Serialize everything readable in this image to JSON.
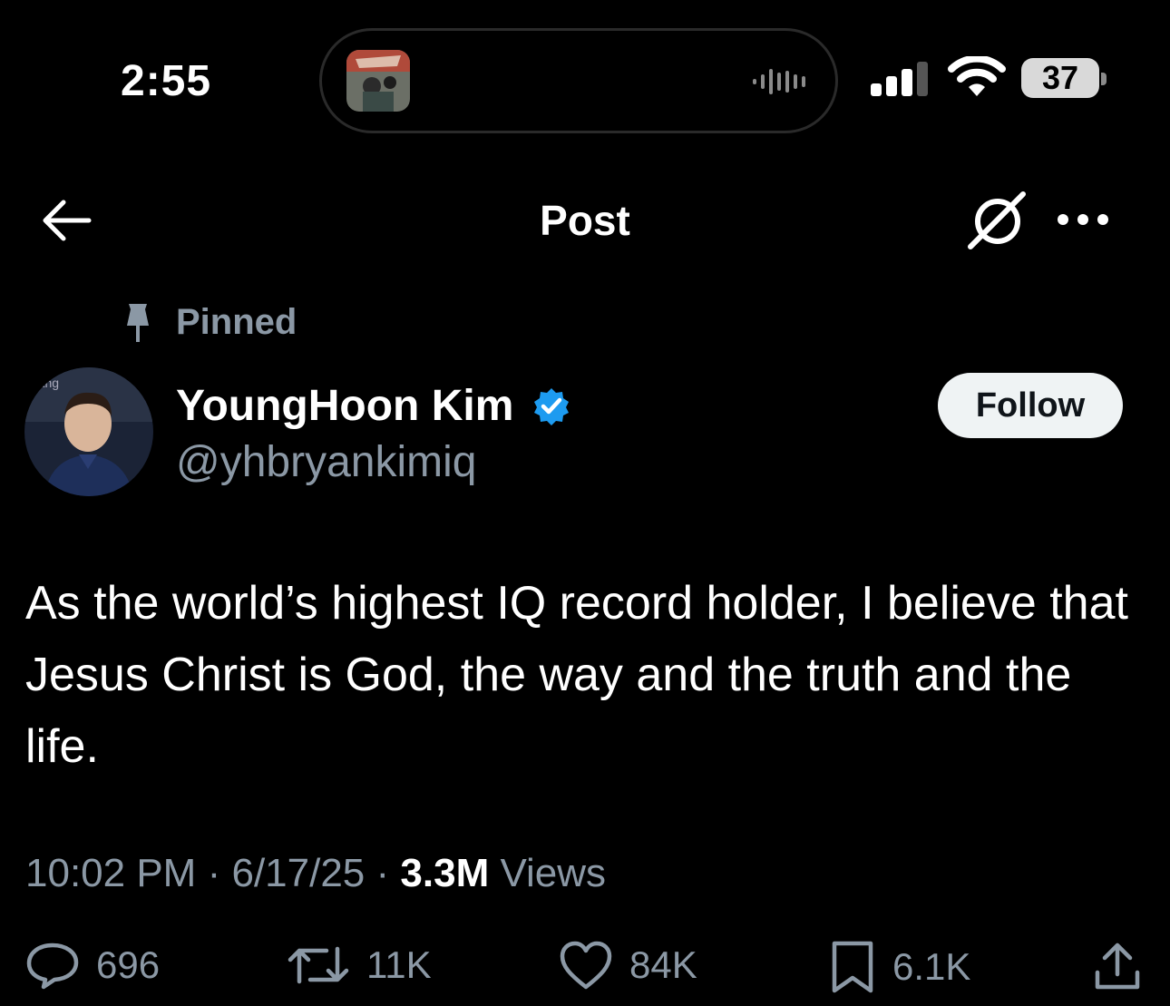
{
  "status_bar": {
    "time": "2:55",
    "battery": "37"
  },
  "nav": {
    "title": "Post"
  },
  "post": {
    "pinned_label": "Pinned",
    "author_name": "YoungHoon Kim",
    "handle": "@yhbryankimiq",
    "follow_label": "Follow",
    "text": "As the world’s highest IQ record holder, I believe that Jesus Christ is God, the way and the truth and the life.",
    "time": "10:02 PM",
    "date": "6/17/25",
    "views_count": "3.3M",
    "views_label": "Views",
    "separator": "·"
  },
  "actions": {
    "replies": "696",
    "reposts": "11K",
    "likes": "84K",
    "bookmarks": "6.1K"
  },
  "colors": {
    "background": "#000000",
    "secondary_text": "#8b98a5",
    "verified": "#1d9bf0",
    "follow_bg": "#eff3f4"
  }
}
